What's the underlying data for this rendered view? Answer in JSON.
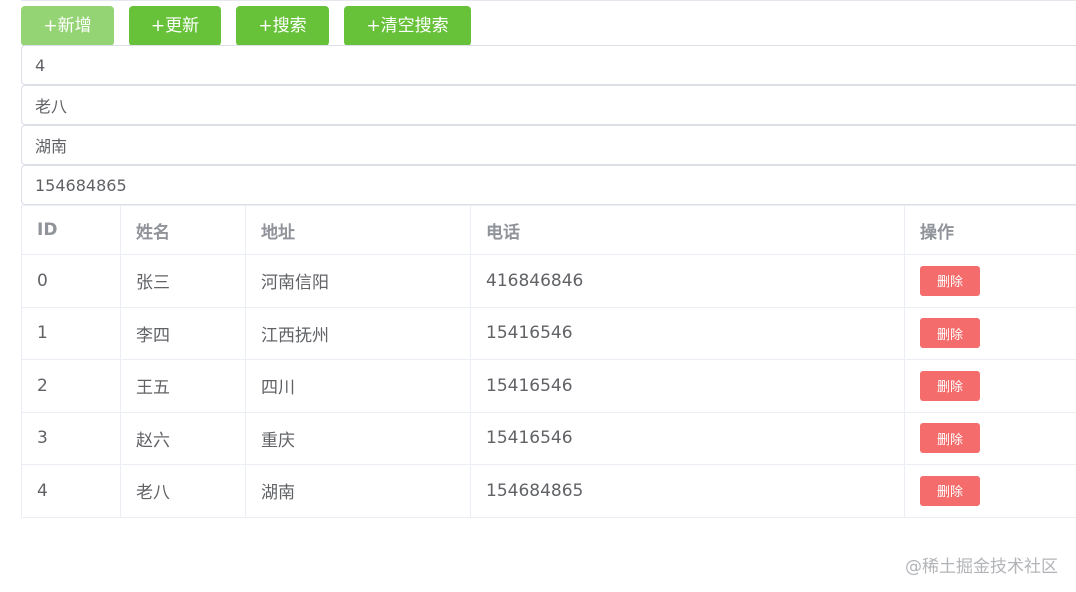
{
  "toolbar": {
    "add_label": "+新增",
    "update_label": "+更新",
    "search_label": "+搜索",
    "clear_label": "+清空搜索",
    "colors": {
      "add": "#95d475",
      "primary": "#67c23a",
      "danger": "#f56c6c"
    }
  },
  "form": {
    "id_value": "4",
    "name_value": "老八",
    "address_value": "湖南",
    "phone_value": "154684865"
  },
  "table": {
    "headers": {
      "id": "ID",
      "name": "姓名",
      "address": "地址",
      "phone": "电话",
      "actions": "操作"
    },
    "rows": [
      {
        "id": "0",
        "name": "张三",
        "address": "河南信阳",
        "phone": "416846846",
        "action": "删除"
      },
      {
        "id": "1",
        "name": "李四",
        "address": "江西抚州",
        "phone": "15416546",
        "action": "删除"
      },
      {
        "id": "2",
        "name": "王五",
        "address": "四川",
        "phone": "15416546",
        "action": "删除"
      },
      {
        "id": "3",
        "name": "赵六",
        "address": "重庆",
        "phone": "15416546",
        "action": "删除"
      },
      {
        "id": "4",
        "name": "老八",
        "address": "湖南",
        "phone": "154684865",
        "action": "删除"
      }
    ]
  },
  "watermark": "@稀土掘金技术社区"
}
